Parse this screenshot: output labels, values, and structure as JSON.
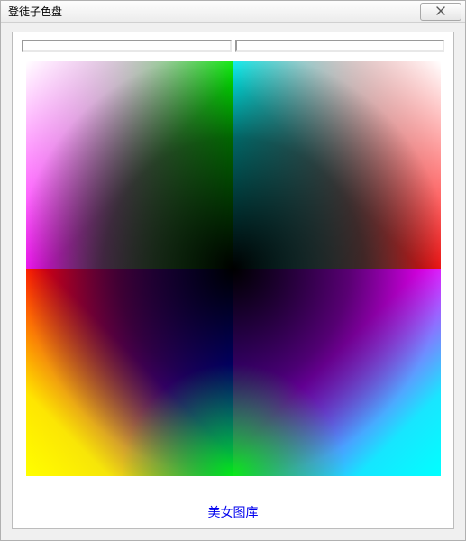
{
  "window": {
    "title": "登徒子色盘"
  },
  "inputs": {
    "left_value": "",
    "right_value": ""
  },
  "link": {
    "label": "美女图库"
  }
}
